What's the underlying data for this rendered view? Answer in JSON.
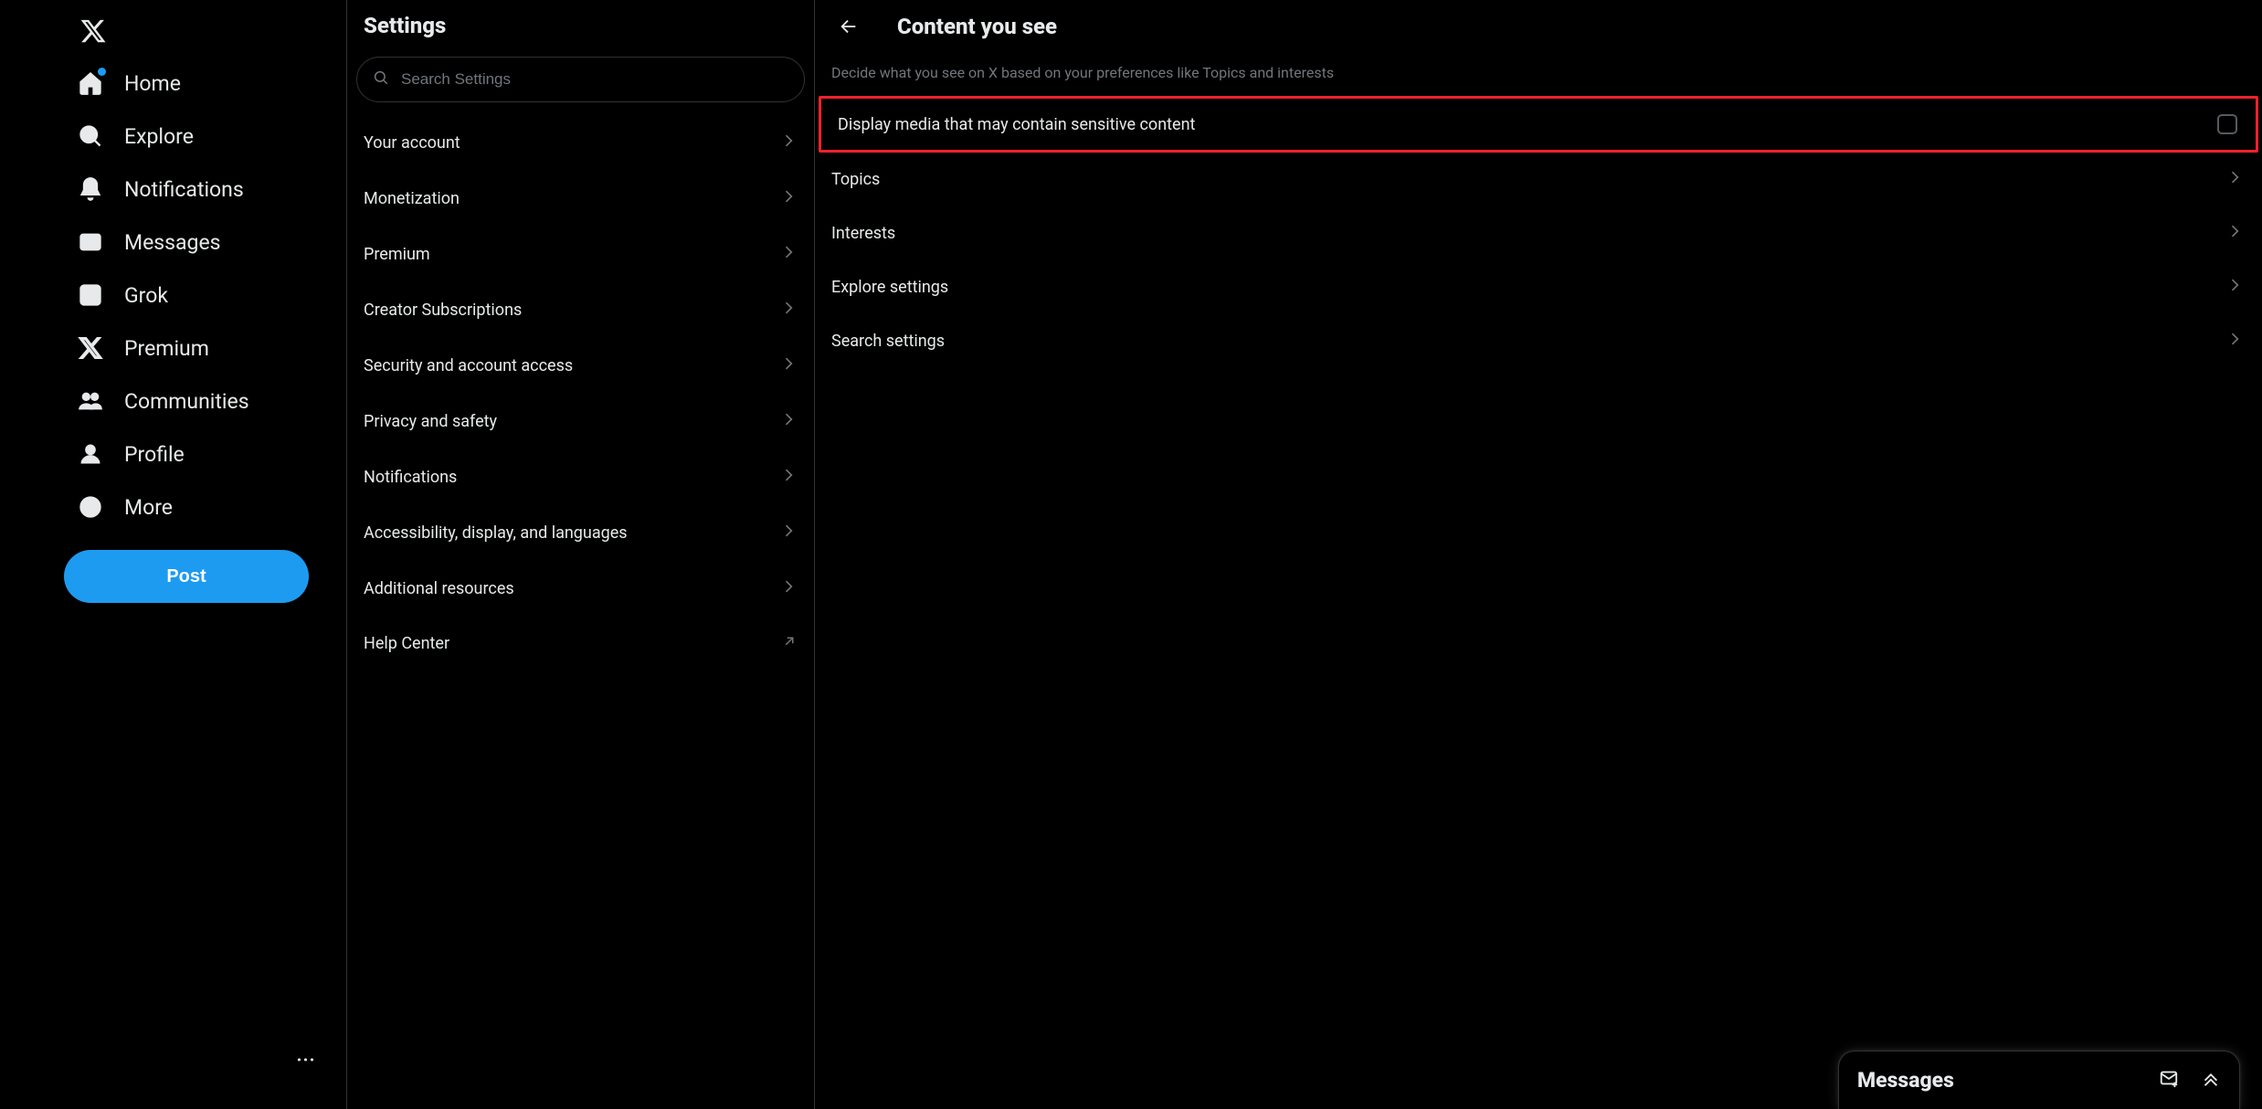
{
  "nav": {
    "items": [
      {
        "label": "Home"
      },
      {
        "label": "Explore"
      },
      {
        "label": "Notifications"
      },
      {
        "label": "Messages"
      },
      {
        "label": "Grok"
      },
      {
        "label": "Premium"
      },
      {
        "label": "Communities"
      },
      {
        "label": "Profile"
      },
      {
        "label": "More"
      }
    ],
    "post_label": "Post"
  },
  "settings": {
    "title": "Settings",
    "search_placeholder": "Search Settings",
    "items": [
      {
        "label": "Your account"
      },
      {
        "label": "Monetization"
      },
      {
        "label": "Premium"
      },
      {
        "label": "Creator Subscriptions"
      },
      {
        "label": "Security and account access"
      },
      {
        "label": "Privacy and safety"
      },
      {
        "label": "Notifications"
      },
      {
        "label": "Accessibility, display, and languages"
      },
      {
        "label": "Additional resources"
      },
      {
        "label": "Help Center"
      }
    ]
  },
  "detail": {
    "title": "Content you see",
    "description": "Decide what you see on X based on your preferences like Topics and interests",
    "sensitive_label": "Display media that may contain sensitive content",
    "items": [
      {
        "label": "Topics"
      },
      {
        "label": "Interests"
      },
      {
        "label": "Explore settings"
      },
      {
        "label": "Search settings"
      }
    ]
  },
  "dock": {
    "title": "Messages"
  }
}
